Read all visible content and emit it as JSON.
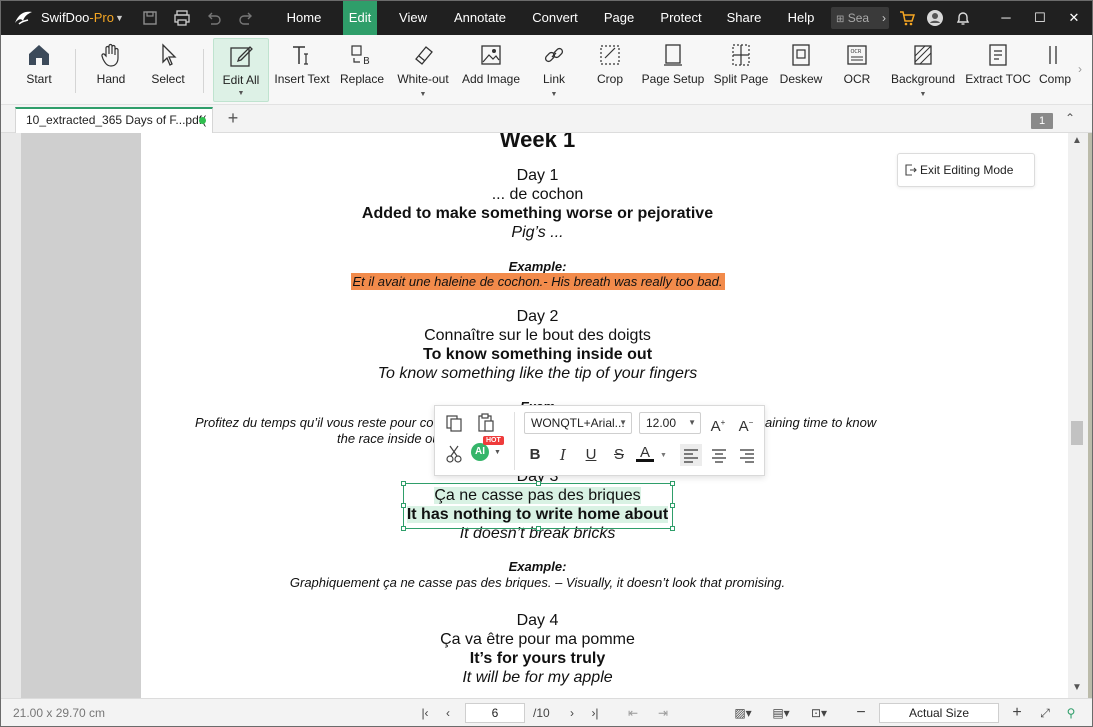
{
  "app": {
    "name": "SwifDoo",
    "name_suffix": "-Pro",
    "menus": [
      "Home",
      "Edit",
      "View",
      "Annotate",
      "Convert",
      "Page",
      "Protect",
      "Share",
      "Help"
    ],
    "active_menu": "Edit",
    "search_placeholder": "Sea"
  },
  "ribbon": {
    "buttons": [
      {
        "label": "Start",
        "icon": "home-icon"
      },
      {
        "label": "Hand",
        "icon": "hand-icon"
      },
      {
        "label": "Select",
        "icon": "cursor-icon"
      },
      {
        "label": "Edit All",
        "icon": "edit-box-icon",
        "active": true
      },
      {
        "label": "Insert Text",
        "icon": "insert-text-icon"
      },
      {
        "label": "Replace",
        "icon": "replace-icon"
      },
      {
        "label": "White-out",
        "icon": "eraser-icon"
      },
      {
        "label": "Add Image",
        "icon": "image-icon"
      },
      {
        "label": "Link",
        "icon": "link-icon"
      },
      {
        "label": "Crop",
        "icon": "crop-icon"
      },
      {
        "label": "Page Setup",
        "icon": "page-setup-icon"
      },
      {
        "label": "Split Page",
        "icon": "split-page-icon"
      },
      {
        "label": "Deskew",
        "icon": "deskew-icon"
      },
      {
        "label": "OCR",
        "icon": "ocr-icon"
      },
      {
        "label": "Background",
        "icon": "background-icon"
      },
      {
        "label": "Extract TOC",
        "icon": "extract-toc-icon"
      },
      {
        "label": "Comp",
        "icon": "compare-icon"
      }
    ]
  },
  "tabs": {
    "doc_name": "10_extracted_365 Days of F...pdf(",
    "page_badge": "1"
  },
  "document": {
    "week_title": "Week 1",
    "day1": {
      "title": "Day 1",
      "fr": "... de cochon",
      "en": "Added to make something worse or pejorative",
      "lit": "Pig’s ...",
      "example_label": "Example:",
      "example": "Et il avait une haleine de cochon.- His breath was really too bad."
    },
    "day2": {
      "title": "Day 2",
      "fr": "Connaître sur le bout des doigts",
      "en": "To know something inside out",
      "lit": "To know something like the tip of your fingers",
      "example_label": "Exam",
      "example_a": "Profitez du temps qu’il vous reste pour co",
      "example_b": "aining time to know",
      "example_c": "the race inside ou"
    },
    "day3": {
      "title": "Day 3",
      "fr": "Ça ne casse pas des briques",
      "en": "It has nothing to write home about",
      "lit": "It doesn’t break bricks",
      "example_label": "Example:",
      "example": "Graphiquement ça ne casse pas des briques. – Visually, it doesn’t look that promising."
    },
    "day4": {
      "title": "Day 4",
      "fr": "Ça va être pour ma pomme",
      "en": "It’s for yours truly",
      "lit": "It will be for my apple"
    }
  },
  "editing": {
    "exit_label": "Exit Editing Mode",
    "font_name": "WONQTL+Arial...",
    "font_size": "12.00",
    "ai_label": "AI",
    "hot_label": "HOT"
  },
  "status": {
    "page_size": "21.00 x 29.70 cm",
    "current_page": "6",
    "total_pages": "/10",
    "zoom": "Actual Size"
  },
  "colors": {
    "accent": "#2f9e6a",
    "highlight": "#f28b4b",
    "selection_fill": "#d9f2e4"
  }
}
